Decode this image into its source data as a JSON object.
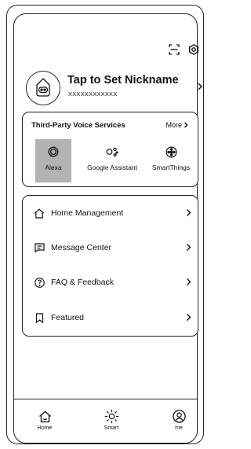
{
  "header": {
    "scan_icon": "scan-icon",
    "settings_icon": "gear-icon"
  },
  "profile": {
    "nickname": "Tap to Set Nickname",
    "user_id": "XXXXXXXXXXXX",
    "avatar_icon": "robot-avatar-icon"
  },
  "voice_services": {
    "title": "Third-Party Voice Services",
    "more_label": "More",
    "selected_highlight_color": "#b3b3b3",
    "items": [
      {
        "label": "Alexa",
        "icon": "alexa-icon",
        "selected": true
      },
      {
        "label": "Google Assistant",
        "icon": "google-assistant-icon",
        "selected": false
      },
      {
        "label": "SmartThings",
        "icon": "smartthings-icon",
        "selected": false
      }
    ]
  },
  "menu": {
    "items": [
      {
        "label": "Home Management",
        "icon": "home-icon"
      },
      {
        "label": "Message Center",
        "icon": "message-icon"
      },
      {
        "label": "FAQ & Feedback",
        "icon": "question-icon"
      },
      {
        "label": "Featured",
        "icon": "bookmark-icon"
      }
    ]
  },
  "tabbar": {
    "items": [
      {
        "label": "Home",
        "icon": "home-icon"
      },
      {
        "label": "Smart",
        "icon": "sun-icon"
      },
      {
        "label": "me",
        "icon": "user-icon"
      }
    ]
  }
}
